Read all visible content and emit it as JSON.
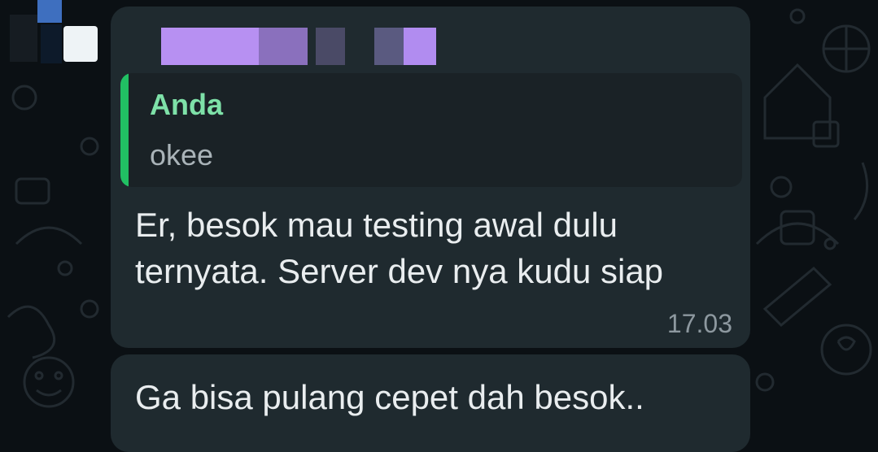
{
  "chat": {
    "messages": [
      {
        "sender": "",
        "quoted": {
          "sender": "Anda",
          "text": "okee"
        },
        "text": "Er, besok mau testing awal dulu\nternyata. Server dev nya kudu siap",
        "time": "17.03"
      },
      {
        "text": "Ga bisa pulang cepet dah besok.."
      }
    ]
  },
  "colors": {
    "background": "#0b1014",
    "bubble": "#1f2a2f",
    "quote_background": "#1a2226",
    "quote_accent": "#21c063",
    "quote_sender": "#7ee1a8",
    "message_text": "#e9edef",
    "timestamp_text": "#8d989f"
  },
  "icons": [
    "wallpaper-doodle-pattern"
  ]
}
